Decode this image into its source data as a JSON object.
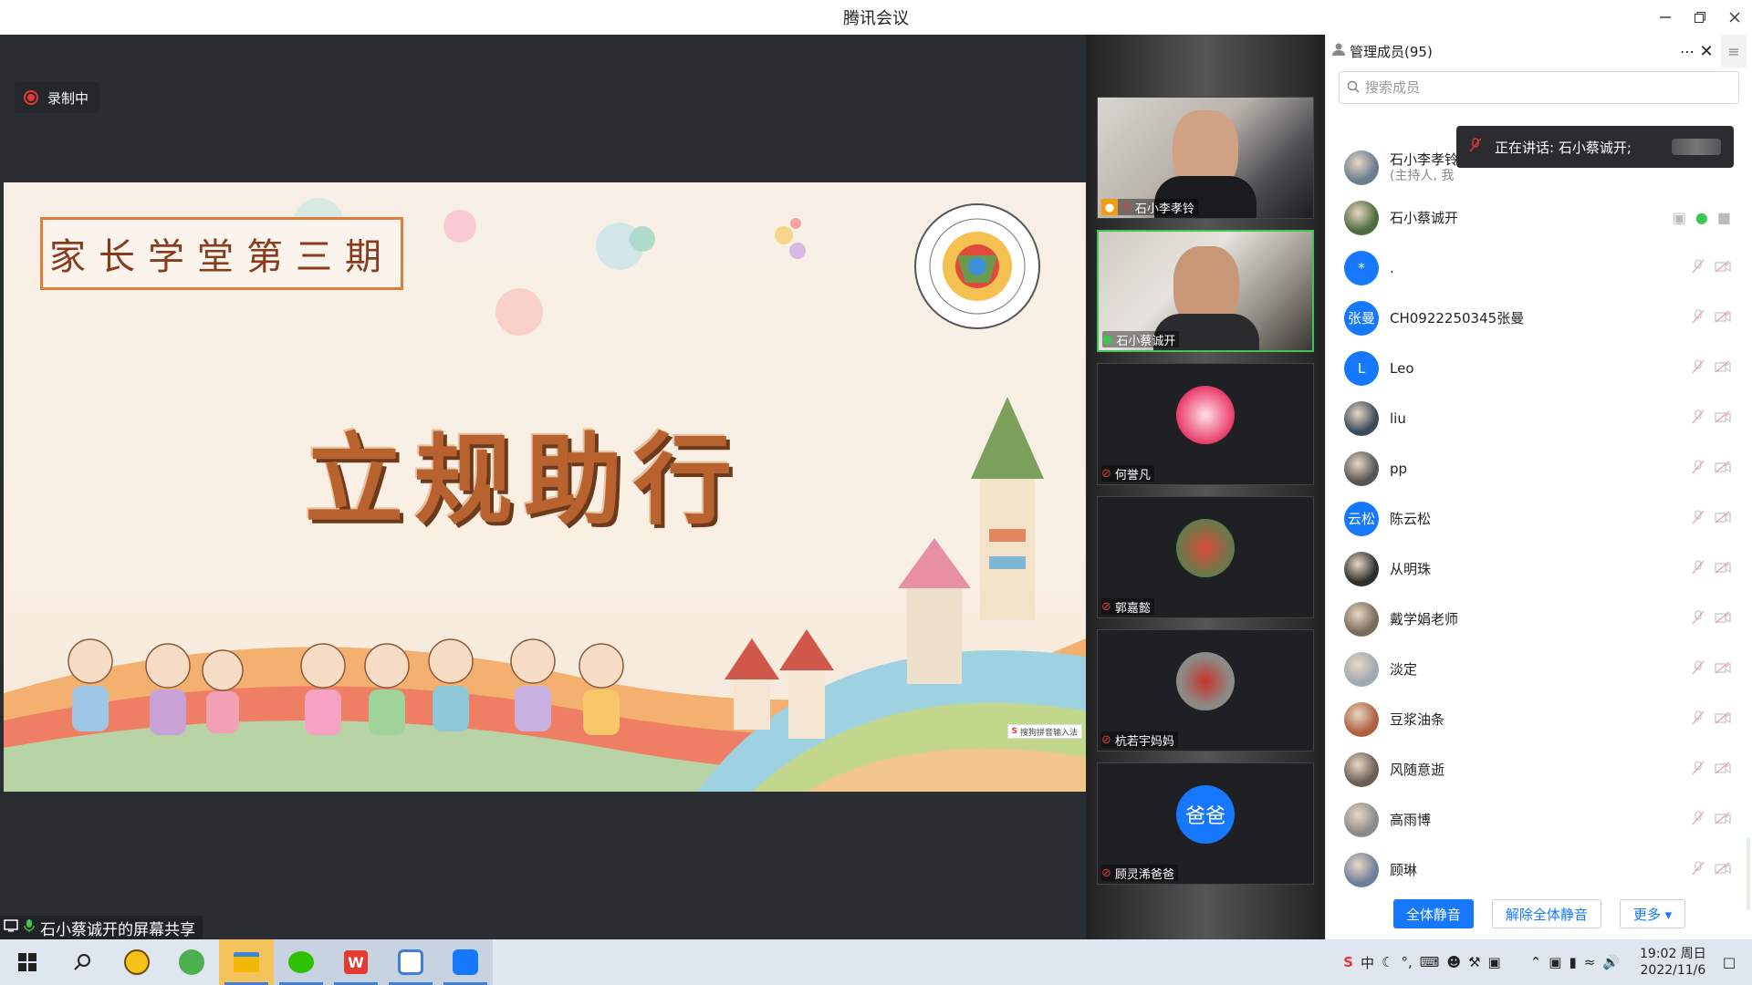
{
  "window": {
    "title": "腾讯会议"
  },
  "recording": {
    "label": "录制中"
  },
  "slide": {
    "series_title": "家长学堂第三期",
    "main_title": "立规助行",
    "ime_badge": "搜狗拼音输入法"
  },
  "share": {
    "label": "石小蔡诚开的屏幕共享"
  },
  "videos": [
    {
      "name": "石小李孝铃",
      "host": true,
      "mic": "muted",
      "type": "camera"
    },
    {
      "name": "石小蔡诚开",
      "mic": "on",
      "type": "camera",
      "speaking": true
    },
    {
      "name": "何誉凡",
      "mic": "muted",
      "type": "avatar"
    },
    {
      "name": "郭嘉懿",
      "mic": "muted",
      "type": "avatar"
    },
    {
      "name": "杭若宇妈妈",
      "mic": "muted",
      "type": "avatar"
    },
    {
      "name": "顾灵浠爸爸",
      "mic": "muted",
      "type": "avatar",
      "avatar_text": "爸爸"
    }
  ],
  "panel": {
    "title": "管理成员(95)",
    "search_placeholder": "搜索成员",
    "speaking_toast": "正在讲话: 石小蔡诚开;",
    "members": [
      {
        "name": "石小李孝铃",
        "sub": "(主持人, 我",
        "avatar": "photo"
      },
      {
        "name": "石小蔡诚开",
        "avatar": "photo",
        "mic": "on"
      },
      {
        "name": ".",
        "avatar_text": "*",
        "avatar": "blue"
      },
      {
        "name": "CH0922250345张曼",
        "avatar_text": "张曼",
        "avatar": "blue"
      },
      {
        "name": "Leo",
        "avatar_text": "L",
        "avatar": "blue"
      },
      {
        "name": "liu",
        "avatar": "photo"
      },
      {
        "name": "pp",
        "avatar": "photo"
      },
      {
        "name": "陈云松",
        "avatar_text": "云松",
        "avatar": "blue"
      },
      {
        "name": "从明珠",
        "avatar": "photo"
      },
      {
        "name": "戴学娟老师",
        "avatar": "photo"
      },
      {
        "name": "淡定",
        "avatar": "photo"
      },
      {
        "name": "豆浆油条",
        "avatar": "photo"
      },
      {
        "name": "风随意逝",
        "avatar": "photo"
      },
      {
        "name": "高雨博",
        "avatar": "photo"
      },
      {
        "name": "顾琳",
        "avatar": "photo"
      }
    ],
    "footer": {
      "mute_all": "全体静音",
      "unmute_all": "解除全体静音",
      "more": "更多 ▾"
    }
  },
  "taskbar": {
    "ime_zh": "中",
    "time": "19:02 周日",
    "date": "2022/11/6"
  },
  "colors": {
    "accent": "#1677ff",
    "speaking": "#3ec552",
    "muted": "#e53935"
  }
}
